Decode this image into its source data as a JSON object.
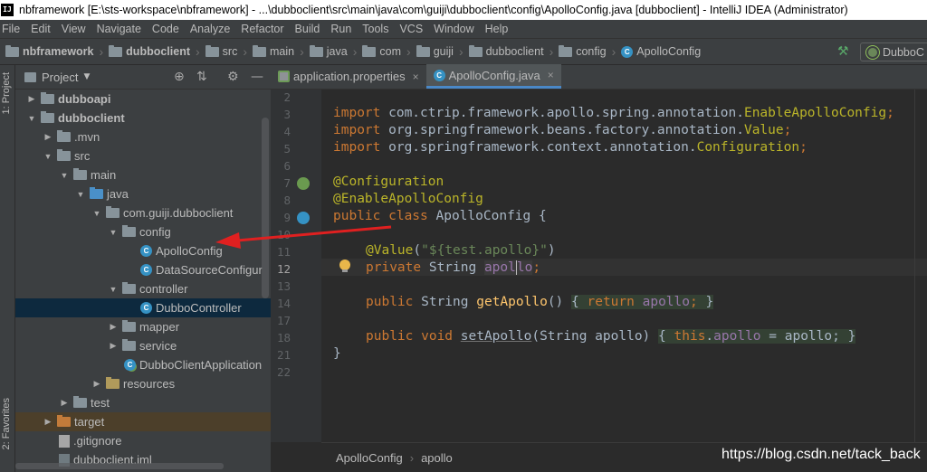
{
  "window": {
    "title": "nbframework [E:\\sts-workspace\\nbframework] - ...\\dubboclient\\src\\main\\java\\com\\guiji\\dubboclient\\config\\ApolloConfig.java [dubboclient] - IntelliJ IDEA (Administrator)",
    "app_icon_text": "IJ"
  },
  "menu": [
    "File",
    "Edit",
    "View",
    "Navigate",
    "Code",
    "Analyze",
    "Refactor",
    "Build",
    "Run",
    "Tools",
    "VCS",
    "Window",
    "Help"
  ],
  "nav_breadcrumb": [
    "nbframework",
    "dubboclient",
    "src",
    "main",
    "java",
    "com",
    "guiji",
    "dubboclient",
    "config",
    "ApolloConfig"
  ],
  "run_config": "DubboC",
  "side_tabs": {
    "project": "1: Project",
    "favorites": "2: Favorites"
  },
  "project_panel": {
    "title": "Project",
    "tree": [
      {
        "label": "dubboapi",
        "indent": 0,
        "arrow": "right",
        "icon": "module",
        "bold": true
      },
      {
        "label": "dubboclient",
        "indent": 0,
        "arrow": "down",
        "icon": "module",
        "bold": true
      },
      {
        "label": ".mvn",
        "indent": 1,
        "arrow": "right",
        "icon": "folder"
      },
      {
        "label": "src",
        "indent": 1,
        "arrow": "down",
        "icon": "folder"
      },
      {
        "label": "main",
        "indent": 2,
        "arrow": "down",
        "icon": "folder"
      },
      {
        "label": "java",
        "indent": 3,
        "arrow": "down",
        "icon": "src-folder"
      },
      {
        "label": "com.guiji.dubboclient",
        "indent": 4,
        "arrow": "down",
        "icon": "folder"
      },
      {
        "label": "config",
        "indent": 5,
        "arrow": "down",
        "icon": "folder"
      },
      {
        "label": "ApolloConfig",
        "indent": 6,
        "arrow": "",
        "icon": "class"
      },
      {
        "label": "DataSourceConfigur",
        "indent": 6,
        "arrow": "",
        "icon": "class"
      },
      {
        "label": "controller",
        "indent": 5,
        "arrow": "down",
        "icon": "folder"
      },
      {
        "label": "DubboController",
        "indent": 6,
        "arrow": "",
        "icon": "class",
        "selected": true
      },
      {
        "label": "mapper",
        "indent": 5,
        "arrow": "right",
        "icon": "folder"
      },
      {
        "label": "service",
        "indent": 5,
        "arrow": "right",
        "icon": "folder"
      },
      {
        "label": "DubboClientApplication",
        "indent": 5,
        "arrow": "",
        "icon": "spring-class"
      },
      {
        "label": "resources",
        "indent": 4,
        "arrow": "right",
        "icon": "res-folder"
      },
      {
        "label": "test",
        "indent": 2,
        "arrow": "right",
        "icon": "folder"
      },
      {
        "label": "target",
        "indent": 1,
        "arrow": "right",
        "icon": "orange-folder",
        "highlight": true
      },
      {
        "label": ".gitignore",
        "indent": 1,
        "arrow": "",
        "icon": "file"
      },
      {
        "label": "dubboclient.iml",
        "indent": 1,
        "arrow": "",
        "icon": "file"
      }
    ]
  },
  "tabs": [
    {
      "label": "application.properties",
      "active": false
    },
    {
      "label": "ApolloConfig.java",
      "active": true
    }
  ],
  "line_numbers": [
    "2",
    "3",
    "4",
    "5",
    "6",
    "7",
    "8",
    "9",
    "10",
    "11",
    "12",
    "13",
    "14",
    "17",
    "18",
    "21",
    "22"
  ],
  "current_line": "12",
  "code": {
    "l3": [
      "import",
      " com.ctrip.framework.apollo.spring.annotation.",
      "EnableApolloConfig",
      ";"
    ],
    "l4": [
      "import",
      " org.springframework.beans.factory.annotation.",
      "Value",
      ";"
    ],
    "l5": [
      "import",
      " org.springframework.context.annotation.",
      "Configuration",
      ";"
    ],
    "l7": "@Configuration",
    "l8": "@EnableApolloConfig",
    "l9": [
      "public class",
      " ApolloConfig {"
    ],
    "l11": [
      "@Value",
      "(",
      "\"${test.apollo}\"",
      ")"
    ],
    "l12": [
      "private",
      " String ",
      "apol",
      "lo",
      ";"
    ],
    "l14": [
      "public",
      " String ",
      "getApollo",
      "() ",
      "{ ",
      "return",
      " ",
      "apollo",
      "; ",
      "}"
    ],
    "l18": [
      "public void",
      " ",
      "setApollo",
      "(String apollo) ",
      "{ ",
      "this",
      ".",
      "apollo",
      " = apollo; ",
      "}"
    ],
    "l21": "}"
  },
  "editor_breadcrumb": [
    "ApolloConfig",
    "apollo"
  ],
  "watermark": "https://blog.csdn.net/tack_back",
  "colors": {
    "accent": "#4a88c7",
    "arrow": "#e02020",
    "keyword": "#cc7832",
    "annotation": "#bbb529",
    "string": "#6a8759",
    "field": "#9876aa",
    "method": "#ffc66d"
  }
}
